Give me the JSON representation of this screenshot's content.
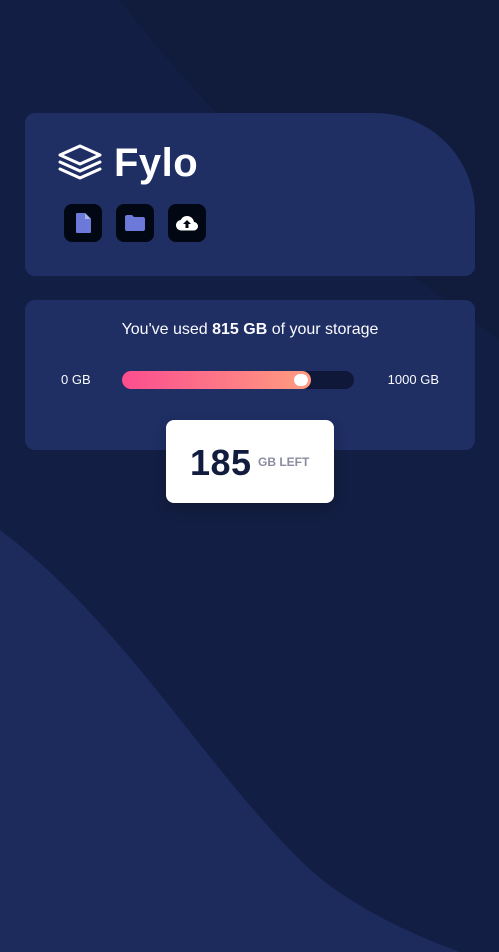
{
  "app": {
    "name": "Fylo"
  },
  "toolbar": {
    "icons": [
      "document-icon",
      "folder-icon",
      "upload-icon"
    ]
  },
  "storage": {
    "text_prefix": "You've used ",
    "used_amount": "815 GB",
    "text_suffix": " of your storage",
    "min_label": "0 GB",
    "max_label": "1000 GB",
    "used_fraction": 0.815,
    "remaining_value": "185",
    "remaining_unit": "GB LEFT"
  },
  "colors": {
    "background": "#121c3e",
    "card": "#1f2e63",
    "icon_accent": "#6d79d8",
    "gradient_start": "#fc4d8e",
    "gradient_end": "#fe9d80"
  }
}
